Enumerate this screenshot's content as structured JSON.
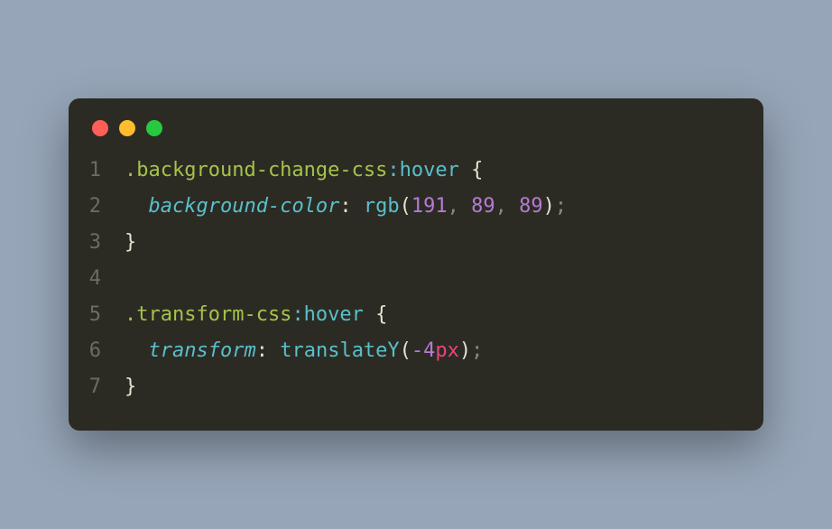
{
  "window": {
    "trafficLights": [
      "close",
      "minimize",
      "zoom"
    ]
  },
  "code": {
    "lines": [
      {
        "n": "1",
        "tokens": [
          {
            "cls": "tok-selector",
            "t": ".background-change-css"
          },
          {
            "cls": "tok-pseudo",
            "t": ":hover"
          },
          {
            "cls": "tok-brace",
            "t": " {"
          }
        ]
      },
      {
        "n": "2",
        "tokens": [
          {
            "cls": "",
            "t": "  "
          },
          {
            "cls": "tok-property",
            "t": "background-color"
          },
          {
            "cls": "tok-colon",
            "t": ": "
          },
          {
            "cls": "tok-func",
            "t": "rgb"
          },
          {
            "cls": "tok-paren",
            "t": "("
          },
          {
            "cls": "tok-number",
            "t": "191"
          },
          {
            "cls": "tok-comma",
            "t": ", "
          },
          {
            "cls": "tok-number",
            "t": "89"
          },
          {
            "cls": "tok-comma",
            "t": ", "
          },
          {
            "cls": "tok-number",
            "t": "89"
          },
          {
            "cls": "tok-paren",
            "t": ")"
          },
          {
            "cls": "tok-semi",
            "t": ";"
          }
        ]
      },
      {
        "n": "3",
        "tokens": [
          {
            "cls": "tok-brace",
            "t": "}"
          }
        ]
      },
      {
        "n": "4",
        "tokens": []
      },
      {
        "n": "5",
        "tokens": [
          {
            "cls": "tok-selector",
            "t": ".transform-css"
          },
          {
            "cls": "tok-pseudo",
            "t": ":hover"
          },
          {
            "cls": "tok-brace",
            "t": " {"
          }
        ]
      },
      {
        "n": "6",
        "tokens": [
          {
            "cls": "",
            "t": "  "
          },
          {
            "cls": "tok-property",
            "t": "transform"
          },
          {
            "cls": "tok-colon",
            "t": ": "
          },
          {
            "cls": "tok-func",
            "t": "translateY"
          },
          {
            "cls": "tok-paren",
            "t": "("
          },
          {
            "cls": "tok-number",
            "t": "-4"
          },
          {
            "cls": "tok-unit",
            "t": "px"
          },
          {
            "cls": "tok-paren",
            "t": ")"
          },
          {
            "cls": "tok-semi",
            "t": ";"
          }
        ]
      },
      {
        "n": "7",
        "tokens": [
          {
            "cls": "tok-brace",
            "t": "}"
          }
        ]
      }
    ]
  }
}
